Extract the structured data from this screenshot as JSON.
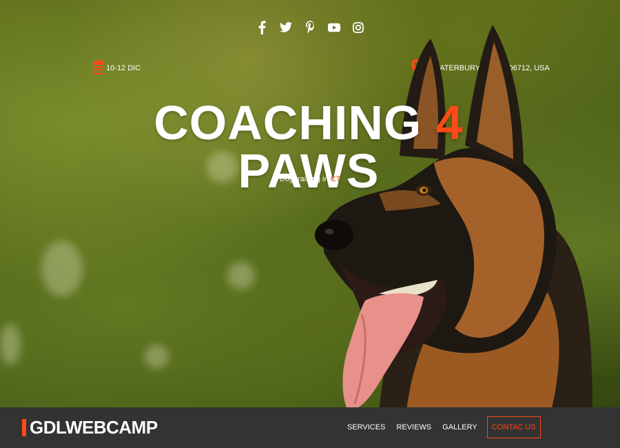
{
  "social": [
    {
      "name": "facebook-icon"
    },
    {
      "name": "twitter-icon"
    },
    {
      "name": "pinterest-icon"
    },
    {
      "name": "youtube-icon"
    },
    {
      "name": "instagram-icon"
    }
  ],
  "event": {
    "date": "10-12 DIC",
    "location": "93 WATERBURY RD CT, 06712, USA"
  },
  "hero": {
    "title_part1": "COACHING ",
    "title_accent": "4",
    "title_part2": " PAWS",
    "subtitle_text": "Dog training in ",
    "subtitle_accent": "CT"
  },
  "navbar": {
    "logo": "GDLWEBCAMP",
    "items": [
      "SERVICES",
      "REVIEWS",
      "GALLERY"
    ],
    "contact": "CONTAC US"
  },
  "colors": {
    "accent": "#fe4918",
    "navbar_bg": "#333333"
  }
}
